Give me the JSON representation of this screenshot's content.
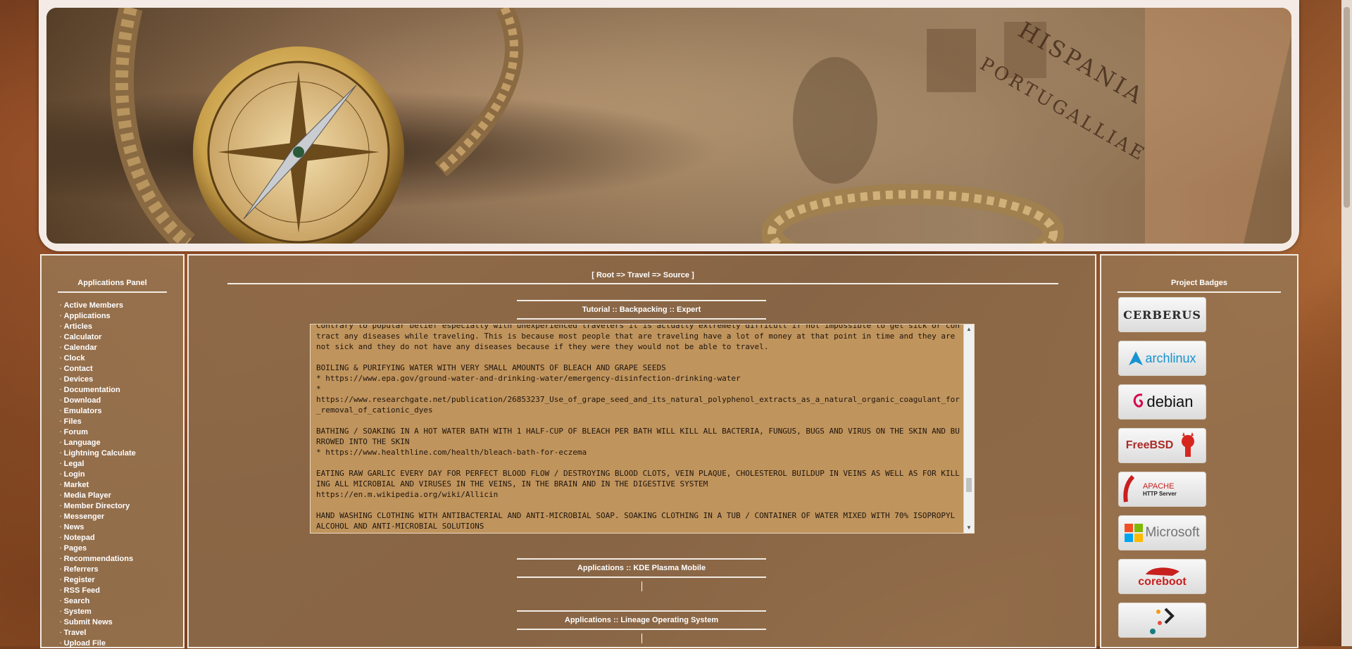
{
  "left_panel": {
    "title": "Applications Panel",
    "items": [
      "Active Members",
      "Applications",
      "Articles",
      "Calculator",
      "Calendar",
      "Clock",
      "Contact",
      "Devices",
      "Documentation",
      "Download",
      "Emulators",
      "Files",
      "Forum",
      "Language",
      "Lightning Calculate",
      "Legal",
      "Login",
      "Market",
      "Media Player",
      "Member Directory",
      "Messenger",
      "News",
      "Notepad",
      "Pages",
      "Recommendations",
      "Referrers",
      "Register",
      "RSS Feed",
      "Search",
      "System",
      "Submit News",
      "Travel",
      "Upload File"
    ]
  },
  "main": {
    "breadcrumb": "[ Root => Travel => Source ]",
    "section1_title": "Tutorial :: Backpacking :: Expert",
    "textbox_content": "Contrary to popular belief especially with unexperienced travelers it is actually extremely difficult if not impossible to get sick or contract any diseases while traveling. This is because most people that are traveling have a lot of money at that point in time and they are not sick and they do not have any diseases because if they were they would not be able to travel.\n\nBOILING & PURIFYING WATER WITH VERY SMALL AMOUNTS OF BLEACH AND GRAPE SEEDS\n* https://www.epa.gov/ground-water-and-drinking-water/emergency-disinfection-drinking-water\n*\nhttps://www.researchgate.net/publication/26853237_Use_of_grape_seed_and_its_natural_polyphenol_extracts_as_a_natural_organic_coagulant_for_removal_of_cationic_dyes\n\nBATHING / SOAKING IN A HOT WATER BATH WITH 1 HALF-CUP OF BLEACH PER BATH WILL KILL ALL BACTERIA, FUNGUS, BUGS AND VIRUS ON THE SKIN AND BURROWED INTO THE SKIN\n* https://www.healthline.com/health/bleach-bath-for-eczema\n\nEATING RAW GARLIC EVERY DAY FOR PERFECT BLOOD FLOW / DESTROYING BLOOD CLOTS, VEIN PLAQUE, CHOLESTEROL BUILDUP IN VEINS AS WELL AS FOR KILLING ALL MICROBIAL AND VIRUSES IN THE VEINS, IN THE BRAIN AND IN THE DIGESTIVE SYSTEM\nhttps://en.m.wikipedia.org/wiki/Allicin\n\nHAND WASHING CLOTHING WITH ANTIBACTERIAL AND ANTI-MICROBIAL SOAP. SOAKING CLOTHING IN A TUB / CONTAINER OF WATER MIXED WITH 70% ISOPROPYL ALCOHOL AND ANTI-MICROBIAL SOLUTIONS",
    "section2_title": "Applications :: KDE Plasma Mobile",
    "section3_title": "Applications :: Lineage Operating System"
  },
  "right_panel": {
    "title": "Project Badges",
    "badges": [
      {
        "name": "cerberus",
        "text": "CERBERUS",
        "color": "#2a2a2a"
      },
      {
        "name": "archlinux",
        "text": "archlinux",
        "color": "#1793d1"
      },
      {
        "name": "debian",
        "text": "debian",
        "color": "#111111",
        "accent": "#d70751"
      },
      {
        "name": "freebsd",
        "text": "FreeBSD",
        "color": "#ab2b28"
      },
      {
        "name": "apache",
        "text": "APACHE",
        "sub": "HTTP Server",
        "color": "#c8201e"
      },
      {
        "name": "microsoft",
        "text": "Microsoft",
        "color": "#737373"
      },
      {
        "name": "coreboot",
        "text": "coreboot",
        "color": "#c8201e"
      },
      {
        "name": "lineage",
        "text": "",
        "color": "#167c80"
      }
    ]
  },
  "banner": {
    "map_text_1": "HISPANIA",
    "map_text_2": "PORTUGALLIAE"
  }
}
